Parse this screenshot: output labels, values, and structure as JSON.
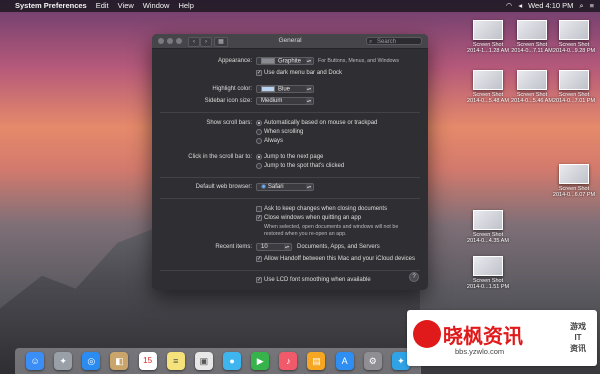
{
  "menubar": {
    "apple": "",
    "app": "System Preferences",
    "items": [
      "Edit",
      "View",
      "Window",
      "Help"
    ],
    "status_date": "Wed 4:10 PM"
  },
  "window": {
    "title": "General",
    "search_placeholder": "Search",
    "appearance_label": "Appearance:",
    "appearance_value": "Graphite",
    "appearance_note": "For Buttons, Menus, and Windows",
    "dark_menu_label": "Use dark menu bar and Dock",
    "highlight_label": "Highlight color:",
    "highlight_value": "Blue",
    "sidebar_size_label": "Sidebar icon size:",
    "sidebar_size_value": "Medium",
    "scrollbars_label": "Show scroll bars:",
    "scroll_opt1": "Automatically based on mouse or trackpad",
    "scroll_opt2": "When scrolling",
    "scroll_opt3": "Always",
    "click_label": "Click in the scroll bar to:",
    "click_opt1": "Jump to the next page",
    "click_opt2": "Jump to the spot that's clicked",
    "browser_label": "Default web browser:",
    "browser_value": "Safari",
    "ask_changes": "Ask to keep changes when closing documents",
    "close_windows": "Close windows when quitting an app",
    "close_windows_note1": "When selected, open documents and windows will not be",
    "close_windows_note2": "restored when you re-open an app.",
    "recent_label": "Recent items:",
    "recent_value": "10",
    "recent_note": "Documents, Apps, and Servers",
    "handoff": "Allow Handoff between this Mac and your iCloud devices",
    "lcd": "Use LCD font smoothing when available",
    "help": "?"
  },
  "desktop_icons": [
    {
      "label1": "Screen Shot",
      "label2": "2014-1...1.28 AM"
    },
    {
      "label1": "Screen Shot",
      "label2": "2014-0...7.11 AM"
    },
    {
      "label1": "Screen Shot",
      "label2": "2014-0...5.48 AM"
    },
    {
      "label1": "Screen Shot",
      "label2": "2014-0...7.01 PM"
    },
    {
      "label1": "Screen Shot",
      "label2": "2014-0...5.46 AM"
    },
    {
      "label1": "Screen Shot",
      "label2": "2014-0...9.28 PM"
    },
    {
      "label1": "Screen Shot",
      "label2": "2014-0...6.07 PM"
    },
    {
      "label1": "Screen Shot",
      "label2": "2014-0...4.35 AM"
    },
    {
      "label1": "Screen Shot",
      "label2": "2014-0...1.51 PM"
    }
  ],
  "dock": [
    "Finder",
    "Launchpad",
    "Safari",
    "Contacts",
    "Calendar",
    "Notes",
    "Preview",
    "Messages",
    "FaceTime",
    "iTunes",
    "iBooks",
    "App Store",
    "System Preferences",
    "Twitter"
  ],
  "dock_calendar_day": "15",
  "watermark": {
    "main": "晓枫资讯",
    "url": "bbs.yzwlo.com",
    "side1": "游戏",
    "side2": "IT",
    "side3": "资讯"
  }
}
